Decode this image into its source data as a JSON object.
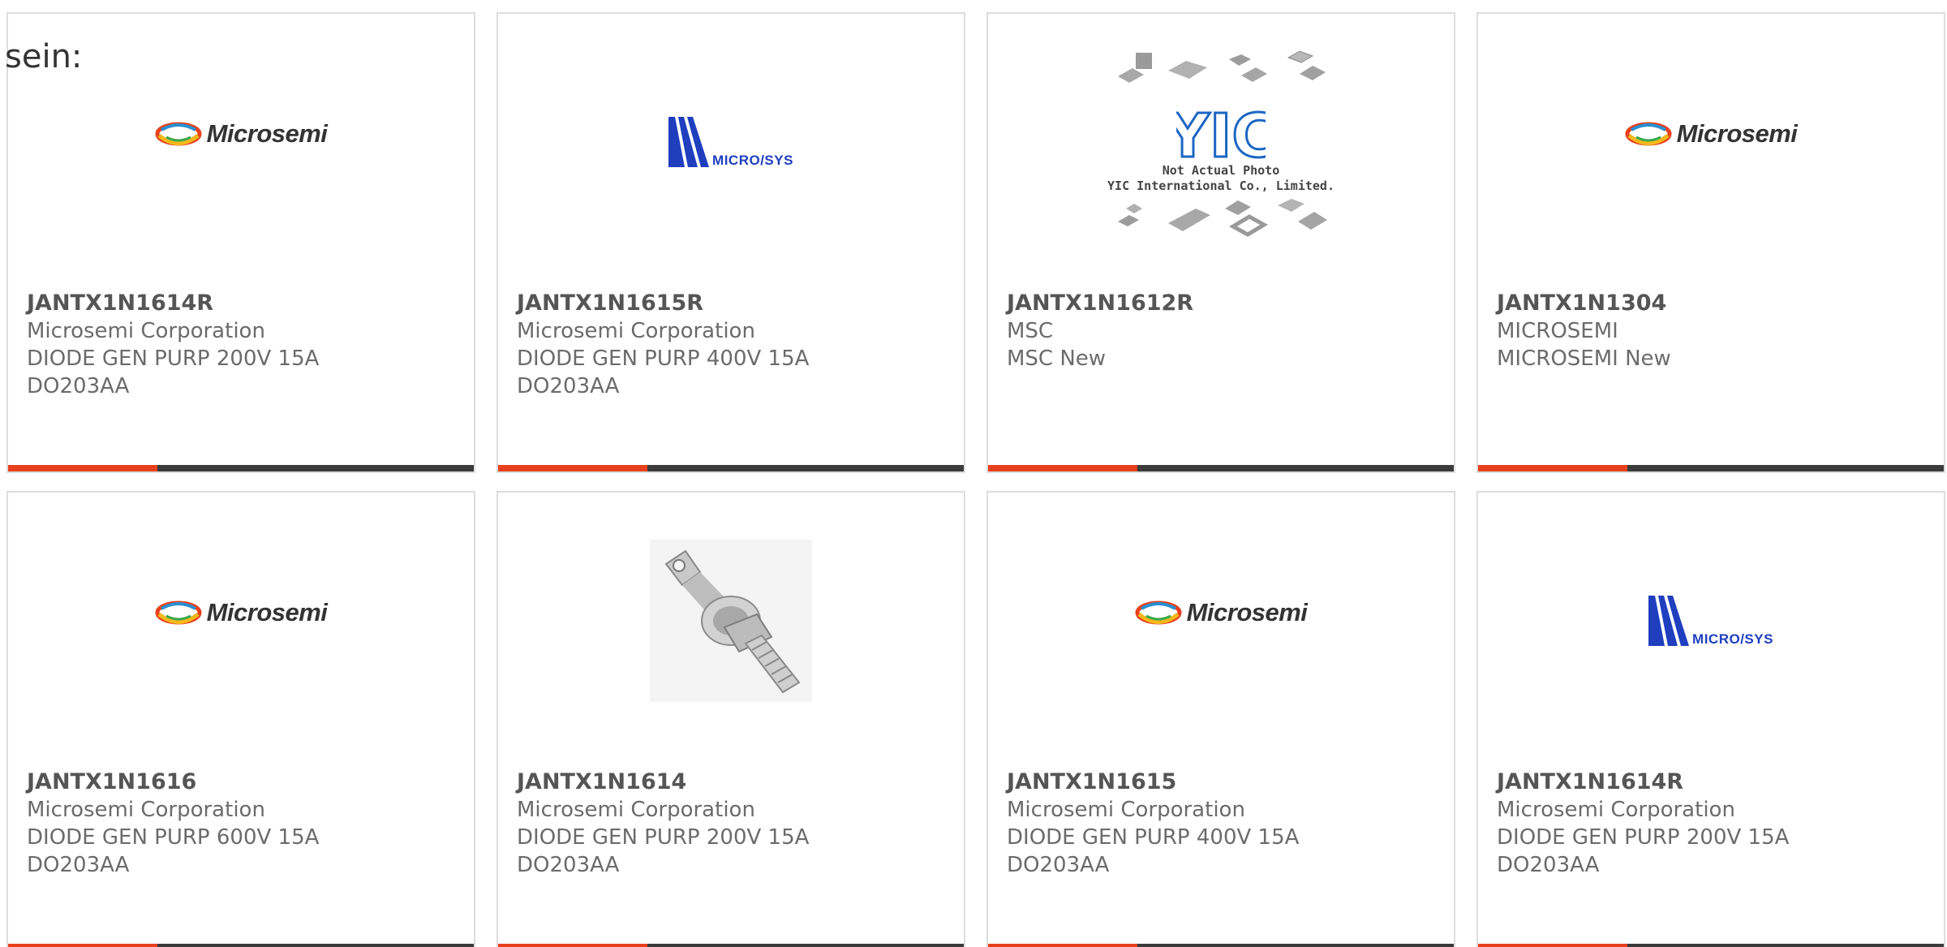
{
  "intro_text": "sein:",
  "products": [
    {
      "part_number": "JANTX1N1614R",
      "manufacturer": "Microsemi Corporation",
      "description": "DIODE GEN PURP 200V 15A",
      "package": "DO203AA",
      "image": "microsemi-logo"
    },
    {
      "part_number": "JANTX1N1615R",
      "manufacturer": "Microsemi Corporation",
      "description": "DIODE GEN PURP 400V 15A",
      "package": "DO203AA",
      "image": "microsys-logo"
    },
    {
      "part_number": "JANTX1N1612R",
      "manufacturer": "MSC",
      "description": "MSC New",
      "package": "",
      "image": "yic-placeholder",
      "image_caption_line1": "Not Actual Photo",
      "image_caption_line2": "YIC International Co., Limited."
    },
    {
      "part_number": "JANTX1N1304",
      "manufacturer": "MICROSEMI",
      "description": "MICROSEMI New",
      "package": "",
      "image": "microsemi-logo"
    },
    {
      "part_number": "JANTX1N1616",
      "manufacturer": "Microsemi Corporation",
      "description": "DIODE GEN PURP 600V 15A",
      "package": "DO203AA",
      "image": "microsemi-logo"
    },
    {
      "part_number": "JANTX1N1614",
      "manufacturer": "Microsemi Corporation",
      "description": "DIODE GEN PURP 200V 15A",
      "package": "DO203AA",
      "image": "stud-diode-photo"
    },
    {
      "part_number": "JANTX1N1615",
      "manufacturer": "Microsemi Corporation",
      "description": "DIODE GEN PURP 400V 15A",
      "package": "DO203AA",
      "image": "microsemi-logo"
    },
    {
      "part_number": "JANTX1N1614R",
      "manufacturer": "Microsemi Corporation",
      "description": "DIODE GEN PURP 200V 15A",
      "package": "DO203AA",
      "image": "microsys-logo"
    }
  ],
  "logo_text": {
    "microsemi": "Microsemi",
    "microsys": "MICRO/SYS",
    "yic": "YIC"
  },
  "colors": {
    "accent": "#e8401c",
    "bar_dark": "#3b3b3b",
    "card_border": "#dddddd",
    "text_muted": "#6b6b6b",
    "microsys_blue": "#1f3fbf"
  }
}
